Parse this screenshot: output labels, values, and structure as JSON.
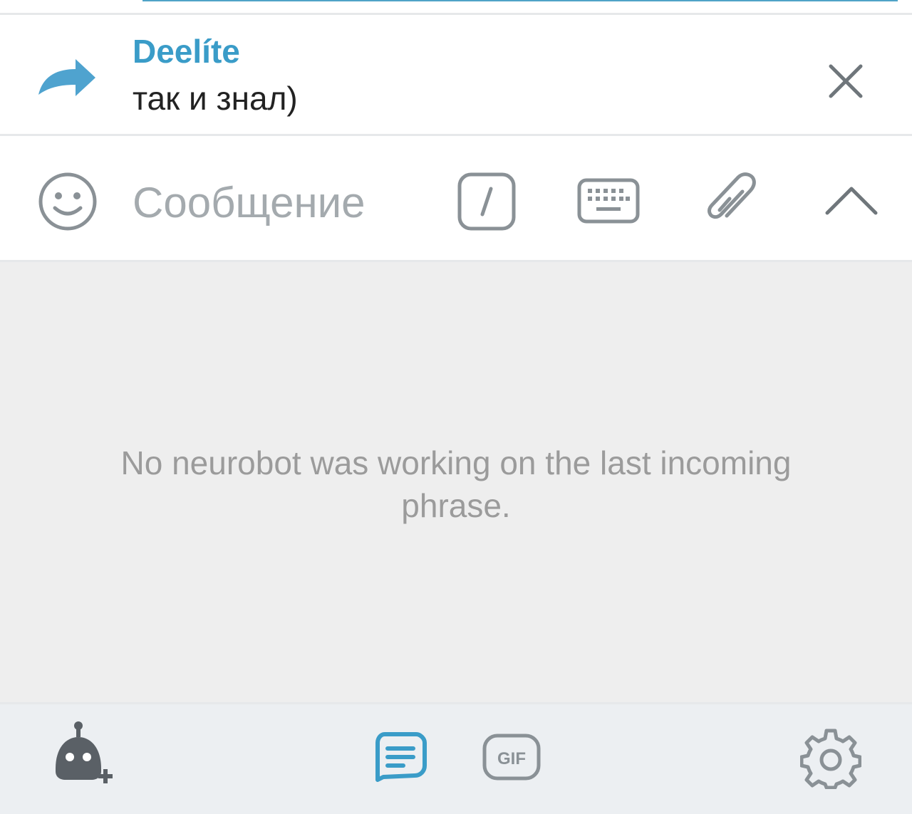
{
  "reply": {
    "author": "Deelíte",
    "text": "так и знал)"
  },
  "composer": {
    "placeholder": "Сообщение"
  },
  "panel": {
    "message": "No neurobot was working on the last incoming phrase."
  },
  "bottom_tabs": {
    "gif_label": "GIF"
  },
  "colors": {
    "accent": "#3a9cc8",
    "icon_gray": "#8a9196",
    "panel_bg": "#eeeeee",
    "bottom_bg": "#eceff2"
  },
  "icons": [
    "reply-arrow-icon",
    "close-icon",
    "emoji-icon",
    "bot-command-icon",
    "keyboard-icon",
    "paperclip-icon",
    "chevron-up-icon",
    "add-robot-icon",
    "text-message-icon",
    "gif-icon",
    "gear-icon"
  ]
}
